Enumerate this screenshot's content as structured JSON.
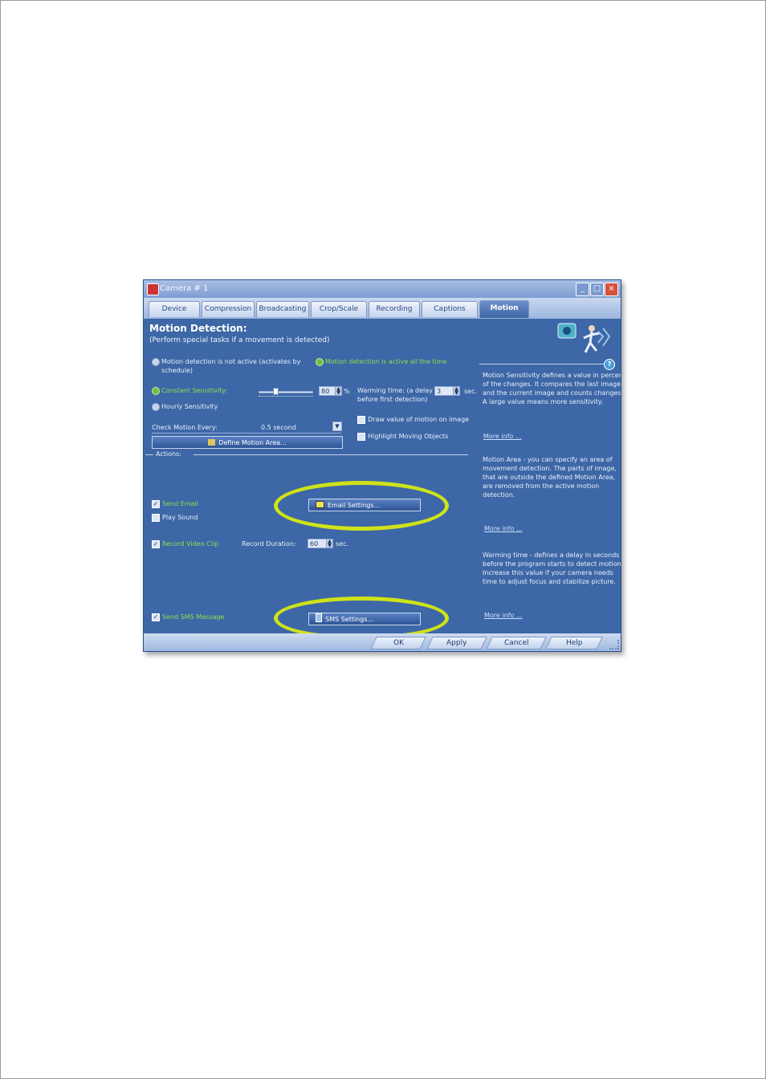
{
  "window": {
    "title": "Camera # 1",
    "min_glyph": "_",
    "max_glyph": "□",
    "close_glyph": "×"
  },
  "tabs": [
    "Device",
    "Compression",
    "Broadcasting",
    "Crop/Scale",
    "Recording",
    "Captions",
    "Motion"
  ],
  "active_tab": "Motion",
  "motion": {
    "heading": "Motion Detection:",
    "subheading": "(Perform special tasks if a movement is detected)",
    "radio_inactive": "Motion detection is not active (activates by",
    "radio_inactive_line2": "schedule)",
    "radio_active": "Motion detection is active all the time",
    "constant_sensitivity": "Constant Sensitivity:",
    "sensitivity_value": "80",
    "sensitivity_unit": "%",
    "sensitivity_level": 0.3,
    "hourly_sensitivity": "Hourly Sensitivity",
    "warming_label": "Warming time: (a delay",
    "warming_label2": "before first detection)",
    "warming_value": "3",
    "warming_unit": "sec.",
    "check_every_label": "Check Motion Every:",
    "check_every_value": "0.5 second",
    "draw_value_label": "Draw value of motion on image",
    "highlight_label": "Highlight Moving Objects",
    "define_area_button": "Define Motion Area..."
  },
  "actions": {
    "label": "Actions:",
    "send_email": "Send Email",
    "email_settings_button": "Email Settings...",
    "play_sound": "Play Sound",
    "record_video": "Record Video Clip",
    "record_duration_label": "Record Duration:",
    "record_duration_value": "60",
    "record_duration_unit": "sec.",
    "send_sms": "Send SMS Message",
    "sms_settings_button": "SMS Settings..."
  },
  "help": {
    "help_icon": "?",
    "sensitivity_text": [
      "Motion Sensitivity defines a value in percent",
      "of the changes. It compares the last image",
      "and the current image and counts changes.",
      "A large value means more sensitivity."
    ],
    "area_text": [
      "Motion Area - you can specify an area of",
      "movement detection. The parts of image,",
      "that are outside the defined Motion Area,",
      "are removed from the active motion",
      "detection."
    ],
    "warming_text": [
      "Warming time - defines a delay in seconds",
      "before the program starts to detect motion.",
      "Increase this value if your camera needs",
      "time to adjust focus and stabilize picture."
    ],
    "more_info": "More info ..."
  },
  "buttons": {
    "ok": "OK",
    "apply": "Apply",
    "cancel": "Cancel",
    "help": "Help"
  },
  "colors": {
    "highlight_ellipse": "#cfe21a",
    "panel_bg": "#3d67a6",
    "active_green": "#8be04e"
  }
}
